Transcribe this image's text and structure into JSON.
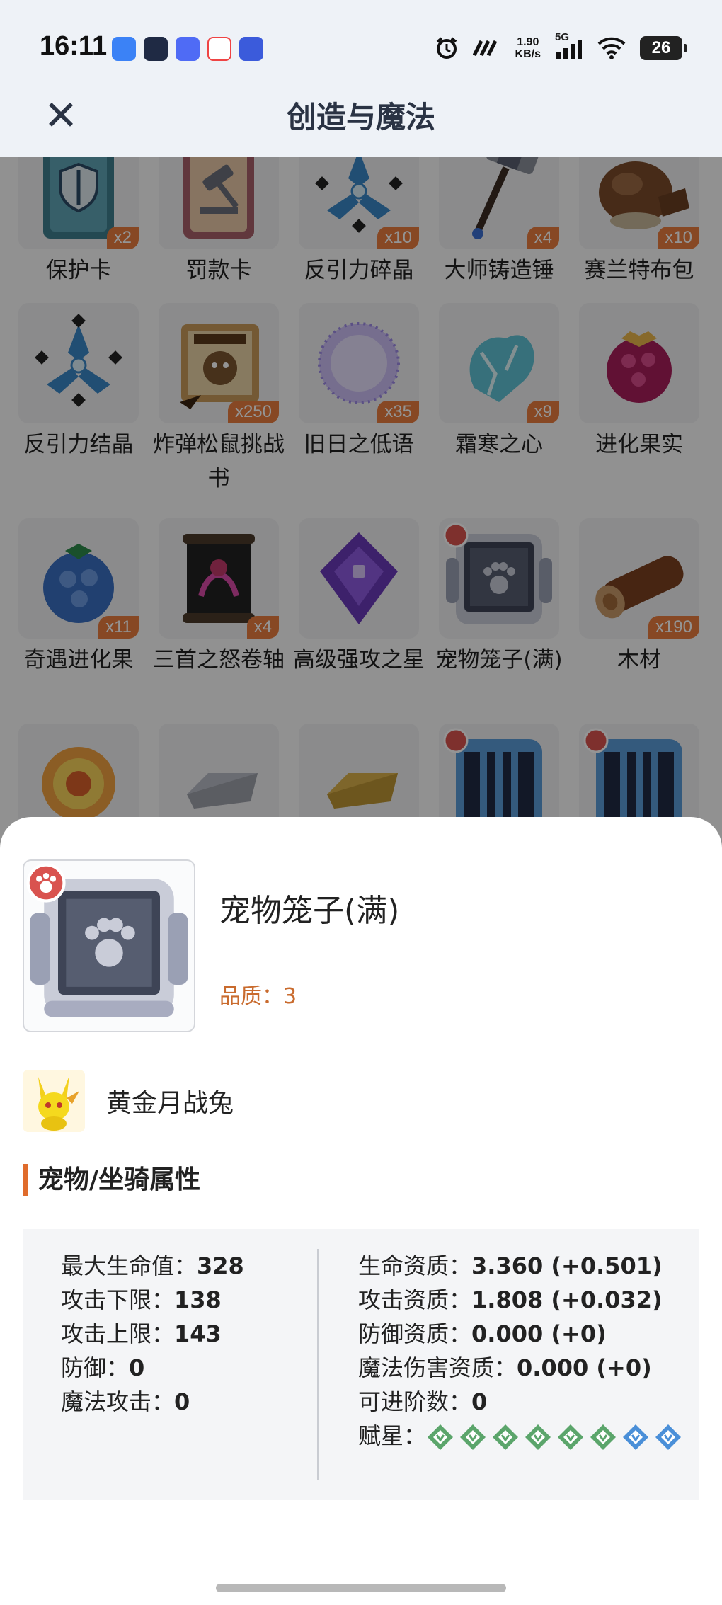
{
  "status_bar": {
    "time": "16:11",
    "net_speed_value": "1.90",
    "net_speed_unit": "KB/s",
    "network": "5G",
    "battery": "26",
    "colors": {
      "app1": "#3b82f6",
      "app2": "#1f2a44",
      "app3": "#4f6bf5",
      "app4": "#ef4444",
      "app5": "#3b5bdb"
    }
  },
  "header": {
    "title": "创造与魔法",
    "close_icon": "close-icon"
  },
  "items": [
    {
      "name": "保护卡",
      "count": "x2",
      "icon": "shield-card-icon"
    },
    {
      "name": "罚款卡",
      "count": "",
      "icon": "gavel-card-icon"
    },
    {
      "name": "反引力碎晶",
      "count": "x10",
      "icon": "crystal-icon"
    },
    {
      "name": "大师铸造锤",
      "count": "x4",
      "icon": "hammer-icon"
    },
    {
      "name": "赛兰特布包",
      "count": "x10",
      "icon": "cloth-bag-icon"
    },
    {
      "name": "反引力结晶",
      "count": "",
      "icon": "crystal-icon"
    },
    {
      "name": "炸弹松鼠挑战书",
      "count": "x250",
      "icon": "wanted-scroll-icon"
    },
    {
      "name": "旧日之低语",
      "count": "x35",
      "icon": "orb-icon"
    },
    {
      "name": "霜寒之心",
      "count": "x9",
      "icon": "frost-heart-icon"
    },
    {
      "name": "进化果实",
      "count": "",
      "icon": "berry-icon"
    },
    {
      "name": "奇遇进化果",
      "count": "x11",
      "icon": "blueberry-icon"
    },
    {
      "name": "三首之怒卷轴",
      "count": "x4",
      "icon": "scroll-icon"
    },
    {
      "name": "高级强攻之星",
      "count": "",
      "icon": "purple-gem-icon"
    },
    {
      "name": "宠物笼子(满)",
      "count": "",
      "icon": "pet-cage-icon"
    },
    {
      "name": "木材",
      "count": "x190",
      "icon": "wood-log-icon"
    },
    {
      "name": "",
      "count": "",
      "icon": "fire-ring-icon"
    },
    {
      "name": "",
      "count": "",
      "icon": "silver-ingot-icon"
    },
    {
      "name": "",
      "count": "",
      "icon": "gold-ingot-icon"
    },
    {
      "name": "",
      "count": "",
      "icon": "blue-cage-icon"
    },
    {
      "name": "",
      "count": "",
      "icon": "blue-cage-icon"
    }
  ],
  "detail": {
    "name": "宠物笼子(满)",
    "quality": "品质：3",
    "pet_name": "黄金月战兔",
    "section_title": "宠物/坐骑属性",
    "stats_left": [
      {
        "label": "最大生命值：",
        "value": "328"
      },
      {
        "label": "攻击下限：",
        "value": "138"
      },
      {
        "label": "攻击上限：",
        "value": "143"
      },
      {
        "label": "防御：",
        "value": "0"
      },
      {
        "label": "魔法攻击：",
        "value": "0"
      }
    ],
    "stats_right": [
      {
        "label": "生命资质：",
        "value": "3.360 (+0.501)"
      },
      {
        "label": "攻击资质：",
        "value": "1.808 (+0.032)"
      },
      {
        "label": "防御资质：",
        "value": "0.000 (+0)"
      },
      {
        "label": "魔法伤害资质：",
        "value": "0.000 (+0)"
      },
      {
        "label": "可进阶数：",
        "value": "0"
      }
    ],
    "stars_label": "赋星：",
    "stars": [
      "green",
      "green",
      "green",
      "green",
      "green",
      "green",
      "blue",
      "blue"
    ],
    "accent_color": "#e06c2c",
    "quality_color": "#c96b2e"
  }
}
